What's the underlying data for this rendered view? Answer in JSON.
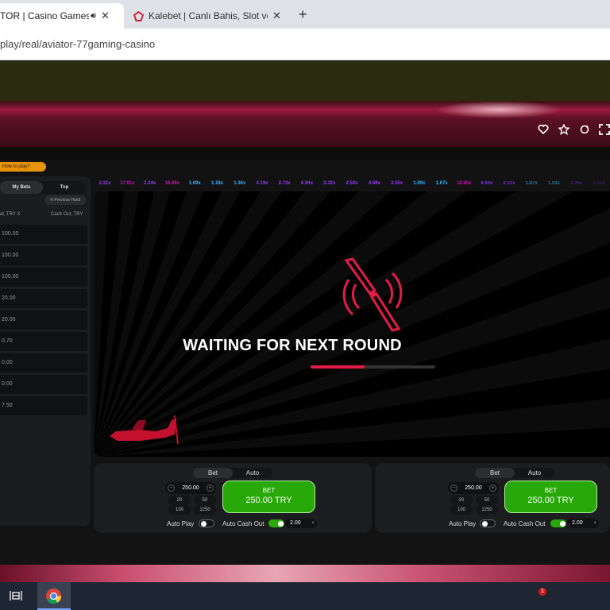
{
  "browser": {
    "tabs": [
      {
        "title": "TOR | Casino Games | C",
        "active": true,
        "audio_icon": "speaker-icon",
        "close": "✕"
      },
      {
        "title": "Kalebet | Canlı Bahis, Slot ve Ca",
        "active": false,
        "close": "✕"
      }
    ],
    "new_tab": "+",
    "url": "play/real/aviator-77gaming-casino"
  },
  "toolbar_icons": [
    "heart-icon",
    "star-icon",
    "refresh-icon",
    "fullscreen-icon"
  ],
  "game": {
    "how_to_play": "How to play?",
    "tabs": {
      "my_bets": "My Bets",
      "top": "Top"
    },
    "previous_hand": "Previous Hand",
    "columns": {
      "bet": "al, TRY X",
      "cashout": "Cash Out, TRY"
    },
    "bets": [
      "100.00",
      "100.00",
      "100.00",
      "20.00",
      "20.00",
      "0.70",
      "0.00",
      "0.00",
      "7.50"
    ],
    "multipliers": [
      {
        "value": "2.31x",
        "color": "#913ef8"
      },
      {
        "value": "17.91x",
        "color": "#c017b4"
      },
      {
        "value": "2.24x",
        "color": "#913ef8"
      },
      {
        "value": "16.66x",
        "color": "#c017b4"
      },
      {
        "value": "1.09x",
        "color": "#34b4ff"
      },
      {
        "value": "1.18x",
        "color": "#34b4ff"
      },
      {
        "value": "1.36x",
        "color": "#34b4ff"
      },
      {
        "value": "4.19x",
        "color": "#913ef8"
      },
      {
        "value": "2.72x",
        "color": "#913ef8"
      },
      {
        "value": "6.94x",
        "color": "#913ef8"
      },
      {
        "value": "2.32x",
        "color": "#913ef8"
      },
      {
        "value": "2.53x",
        "color": "#913ef8"
      },
      {
        "value": "4.69x",
        "color": "#913ef8"
      },
      {
        "value": "2.55x",
        "color": "#913ef8"
      },
      {
        "value": "1.00x",
        "color": "#34b4ff"
      },
      {
        "value": "1.67x",
        "color": "#34b4ff"
      },
      {
        "value": "10.65x",
        "color": "#c017b4"
      },
      {
        "value": "4.33x",
        "color": "#913ef8"
      },
      {
        "value": "2.51x",
        "color": "#913ef8"
      },
      {
        "value": "1.87x",
        "color": "#34b4ff"
      },
      {
        "value": "1.84x",
        "color": "#34b4ff"
      },
      {
        "value": "3.35x",
        "color": "#913ef8"
      },
      {
        "value": "4.41x",
        "color": "#913ef8"
      }
    ],
    "status": "WAITING FOR NEXT ROUND",
    "progress": 0.43,
    "accent": "#e31c47",
    "bet_panels": [
      {
        "switch": {
          "bet": "Bet",
          "auto": "Auto"
        },
        "stake": "250.00",
        "minus": "−",
        "plus": "+",
        "quick": [
          "20",
          "50",
          "100",
          "1250"
        ],
        "bet_label": "BET",
        "bet_amount": "250.00 TRY",
        "auto_play": "Auto Play",
        "auto_cash_out": "Auto Cash Out",
        "cash_out_value": "2.00",
        "x": "×"
      },
      {
        "switch": {
          "bet": "Bet",
          "auto": "Auto"
        },
        "stake": "250.00",
        "minus": "−",
        "plus": "+",
        "quick": [
          "20",
          "50",
          "100",
          "1250"
        ],
        "bet_label": "BET",
        "bet_amount": "250.00 TRY",
        "auto_play": "Auto Play",
        "auto_cash_out": "Auto Cash Out",
        "cash_out_value": "2.00",
        "x": "×"
      }
    ]
  },
  "taskbar": {
    "notification_count": "1"
  }
}
